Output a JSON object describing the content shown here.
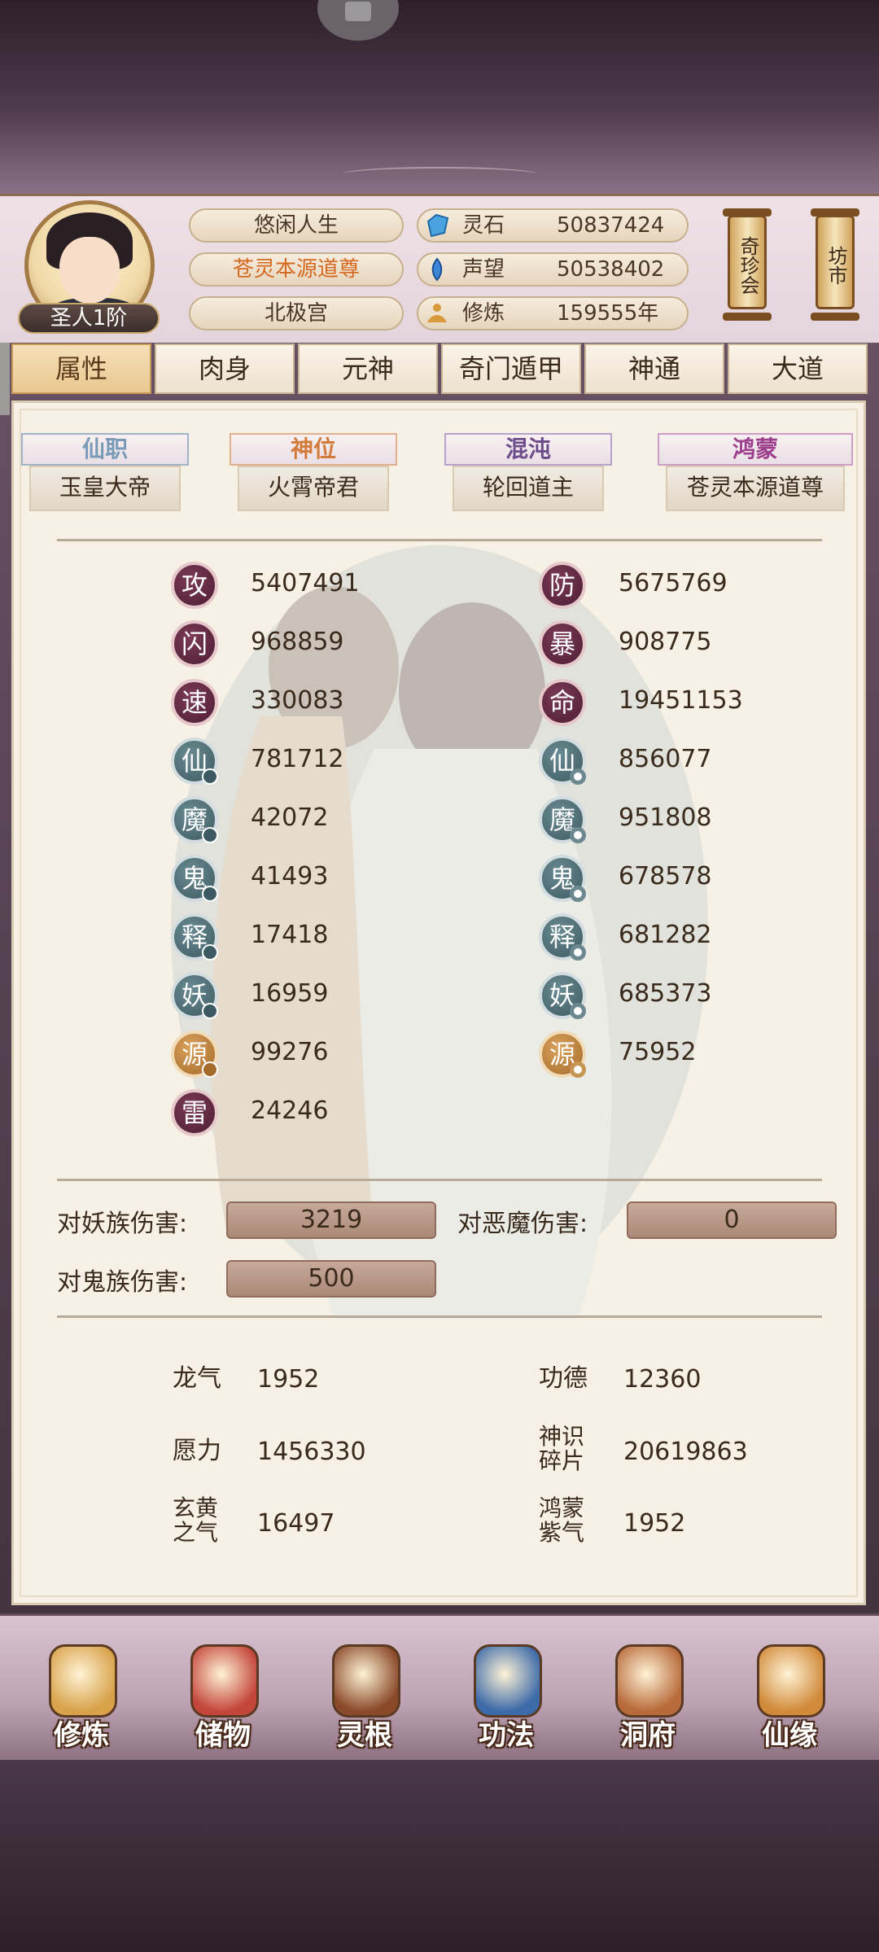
{
  "header": {
    "rank": "圣人1阶",
    "titles": [
      "悠闲人生",
      "苍灵本源道尊",
      "北极宫"
    ],
    "resources": [
      {
        "icon": "spirit-stone-icon",
        "name": "灵石",
        "value": "50837424"
      },
      {
        "icon": "prestige-icon",
        "name": "声望",
        "value": "50538402"
      },
      {
        "icon": "cultivation-icon",
        "name": "修炼",
        "value": "159555年"
      }
    ],
    "scrolls": [
      {
        "label": "奇珍会"
      },
      {
        "label": "坊市"
      }
    ]
  },
  "tabs": [
    "属性",
    "肉身",
    "元神",
    "奇门遁甲",
    "神通",
    "大道"
  ],
  "titles_row": [
    {
      "top": "仙职",
      "bottom": "玉皇大帝",
      "color": "#7a9bb7"
    },
    {
      "top": "神位",
      "bottom": "火霄帝君",
      "color": "#d27b3a"
    },
    {
      "top": "混沌",
      "bottom": "轮回道主",
      "color": "#6d4c8c"
    },
    {
      "top": "鸿蒙",
      "bottom": "苍灵本源道尊",
      "color": "#9c3f8c"
    }
  ],
  "stats_left": [
    {
      "icon": "攻",
      "value": "5407491",
      "style": "red",
      "dot": ""
    },
    {
      "icon": "闪",
      "value": "968859",
      "style": "red",
      "dot": ""
    },
    {
      "icon": "速",
      "value": "330083",
      "style": "red",
      "dot": ""
    },
    {
      "icon": "仙",
      "value": "781712",
      "style": "teal",
      "dot": "dark"
    },
    {
      "icon": "魔",
      "value": "42072",
      "style": "teal",
      "dot": "dark"
    },
    {
      "icon": "鬼",
      "value": "41493",
      "style": "teal",
      "dot": "dark"
    },
    {
      "icon": "释",
      "value": "17418",
      "style": "teal",
      "dot": "dark"
    },
    {
      "icon": "妖",
      "value": "16959",
      "style": "teal",
      "dot": "dark"
    },
    {
      "icon": "源",
      "value": "99276",
      "style": "orange",
      "dot": "ldark"
    },
    {
      "icon": "雷",
      "value": "24246",
      "style": "red",
      "dot": ""
    }
  ],
  "stats_right": [
    {
      "icon": "防",
      "value": "5675769",
      "style": "red",
      "dot": ""
    },
    {
      "icon": "暴",
      "value": "908775",
      "style": "red",
      "dot": ""
    },
    {
      "icon": "命",
      "value": "19451153",
      "style": "red",
      "dot": ""
    },
    {
      "icon": "仙",
      "value": "856077",
      "style": "teal",
      "dot": "light"
    },
    {
      "icon": "魔",
      "value": "951808",
      "style": "teal",
      "dot": "light"
    },
    {
      "icon": "鬼",
      "value": "678578",
      "style": "teal",
      "dot": "light"
    },
    {
      "icon": "释",
      "value": "681282",
      "style": "teal",
      "dot": "light"
    },
    {
      "icon": "妖",
      "value": "685373",
      "style": "teal",
      "dot": "light"
    },
    {
      "icon": "源",
      "value": "75952",
      "style": "orange",
      "dot": "llight"
    }
  ],
  "damage": [
    {
      "label": "对妖族伤害:",
      "value": "3219"
    },
    {
      "label": "对恶魔伤害:",
      "value": "0"
    },
    {
      "label": "对鬼族伤害:",
      "value": "500"
    }
  ],
  "specials": [
    {
      "label": "龙气",
      "value": "1952"
    },
    {
      "label": "功德",
      "value": "12360"
    },
    {
      "label": "愿力",
      "value": "1456330"
    },
    {
      "label": "神识碎片",
      "value": "20619863"
    },
    {
      "label": "玄黄之气",
      "value": "16497"
    },
    {
      "label": "鸿蒙紫气",
      "value": "1952"
    }
  ],
  "nav": [
    {
      "label": "修炼",
      "icon": "monk-icon",
      "color": "#d8a24a"
    },
    {
      "label": "储物",
      "icon": "bag-icon",
      "color": "#c4453a"
    },
    {
      "label": "灵根",
      "icon": "spirit-root-icon",
      "color": "#8a4a2a"
    },
    {
      "label": "功法",
      "icon": "book-icon",
      "color": "#3d6aa8"
    },
    {
      "label": "洞府",
      "icon": "cave-house-icon",
      "color": "#b86a3a"
    },
    {
      "label": "仙缘",
      "icon": "gourd-icon",
      "color": "#d18a3a"
    }
  ]
}
